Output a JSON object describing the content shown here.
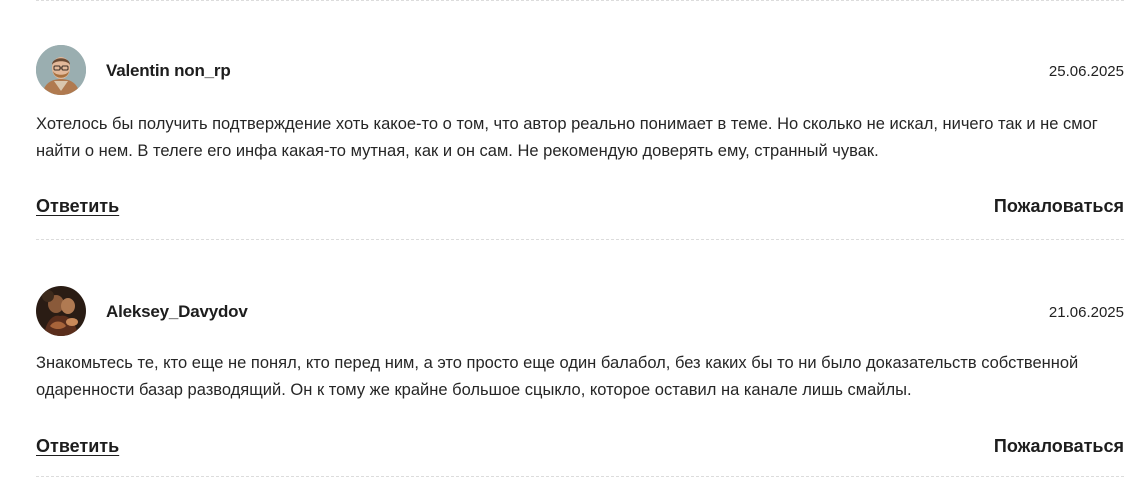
{
  "comments": [
    {
      "author": "Valentin non_rp",
      "date": "25.06.2025",
      "text": "Хотелось бы получить подтверждение хоть какое-то о том, что автор реально понимает в теме. Но сколько не искал, ничего так и не смог найти о нем. В телеге его инфа какая-то мутная, как и он сам. Не рекомендую доверять ему, странный чувак.",
      "reply_label": "Ответить",
      "report_label": "Пожаловаться",
      "avatar_icon": "user-photo-avatar"
    },
    {
      "author": "Aleksey_Davydov",
      "date": "21.06.2025",
      "text": "Знакомьтесь те, кто еще не понял, кто перед ним, а это просто еще один балабол, без каких бы то ни было доказательств собственной одаренности базар разводящий. Он к тому же крайне большое сцыкло, которое оставил на канале лишь смайлы.",
      "reply_label": "Ответить",
      "report_label": "Пожаловаться",
      "avatar_icon": "painting-avatar"
    }
  ],
  "colors": {
    "text": "#262626",
    "separator": "#dcdcdc"
  }
}
